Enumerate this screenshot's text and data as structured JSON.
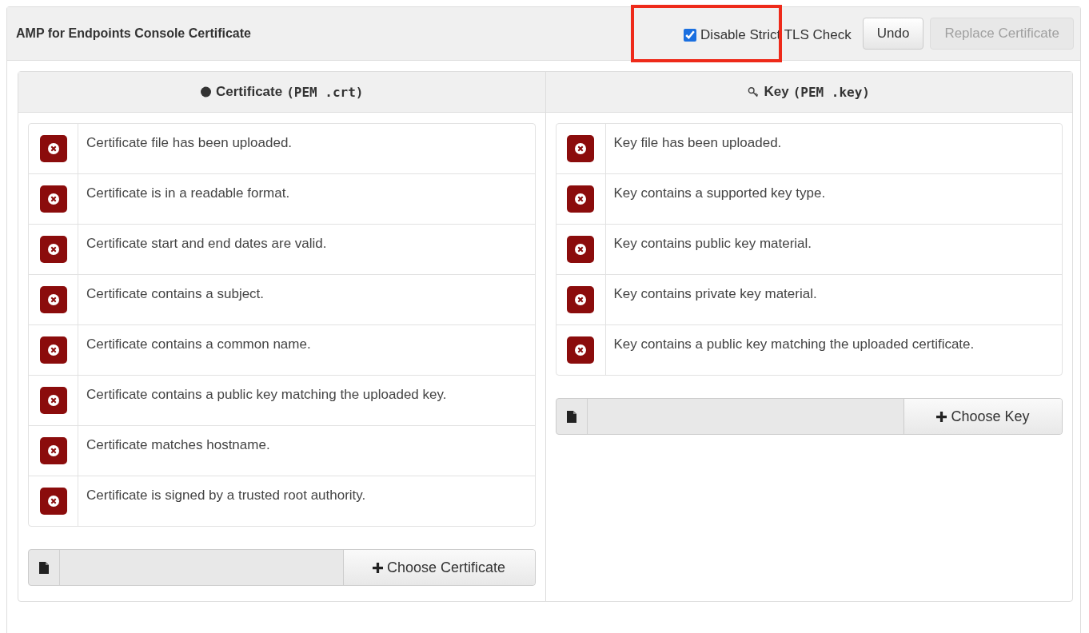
{
  "panel": {
    "title": "AMP for Endpoints Console Certificate",
    "tls_check": {
      "label": "Disable Strict TLS Check",
      "checked": true,
      "highlighted": true
    },
    "buttons": [
      {
        "label": "Undo",
        "disabled": false
      },
      {
        "label": "Replace Certificate",
        "disabled": true
      }
    ]
  },
  "columns": [
    {
      "kind": "certificate",
      "heading": "Certificate",
      "format": "(PEM .crt)",
      "checks": [
        {
          "text": "Certificate file has been uploaded.",
          "passed": false
        },
        {
          "text": "Certificate is in a readable format.",
          "passed": false
        },
        {
          "text": "Certificate start and end dates are valid.",
          "passed": false
        },
        {
          "text": "Certificate contains a subject.",
          "passed": false
        },
        {
          "text": "Certificate contains a common name.",
          "passed": false
        },
        {
          "text": "Certificate contains a public key matching the uploaded key.",
          "passed": false
        },
        {
          "text": "Certificate matches hostname.",
          "passed": false
        },
        {
          "text": "Certificate is signed by a trusted root authority.",
          "passed": false
        }
      ],
      "choose_button": "Choose Certificate"
    },
    {
      "kind": "key",
      "heading": "Key",
      "format": "(PEM .key)",
      "checks": [
        {
          "text": "Key file has been uploaded.",
          "passed": false
        },
        {
          "text": "Key contains a supported key type.",
          "passed": false
        },
        {
          "text": "Key contains public key material.",
          "passed": false
        },
        {
          "text": "Key contains private key material.",
          "passed": false
        },
        {
          "text": "Key contains a public key matching the uploaded certificate.",
          "passed": false
        }
      ],
      "choose_button": "Choose Key"
    }
  ]
}
